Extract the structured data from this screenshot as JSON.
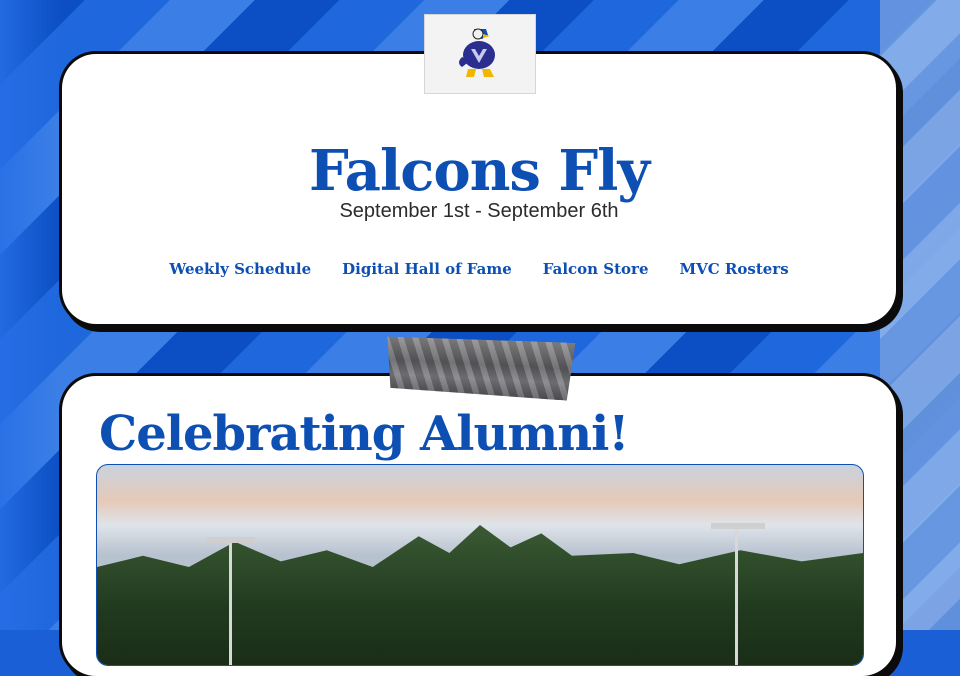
{
  "header": {
    "logo_name": "falcon-mascot-logo",
    "title": "Falcons Fly",
    "subtitle": "September 1st - September 6th",
    "nav": [
      {
        "label": "Weekly Schedule"
      },
      {
        "label": "Digital Hall of Fame"
      },
      {
        "label": "Falcon Store"
      },
      {
        "label": "MVC Rosters"
      }
    ]
  },
  "section": {
    "title": "Celebrating Alumni!"
  },
  "colors": {
    "brand_blue": "#0d4fb3",
    "background_blue": "#1a5fd6",
    "card_border": "#0b0b0b"
  }
}
